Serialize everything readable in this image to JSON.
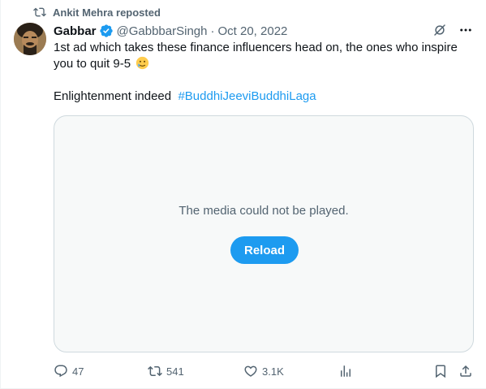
{
  "repost": {
    "text": "Ankit Mehra reposted",
    "icon": "repost-icon"
  },
  "author": {
    "name": "Gabbar",
    "handle": "@GabbbarSingh",
    "date": "Oct 20, 2022",
    "verified": true,
    "avatar": "avatar-image"
  },
  "tweet": {
    "line1": "1st ad which takes these finance influencers head on, the ones who inspire you to quit 9-5",
    "emoji": "crying-smile-emoji",
    "line2_text": "Enlightenment indeed",
    "hashtag": "#BuddhiJeeviBuddhiLaga"
  },
  "media": {
    "message": "The media could not be played.",
    "reload_label": "Reload"
  },
  "actions": {
    "replies": "47",
    "reposts": "541",
    "likes": "3.1K"
  },
  "colors": {
    "accent": "#1d9bf0",
    "muted": "#536471",
    "text": "#0f1419"
  }
}
